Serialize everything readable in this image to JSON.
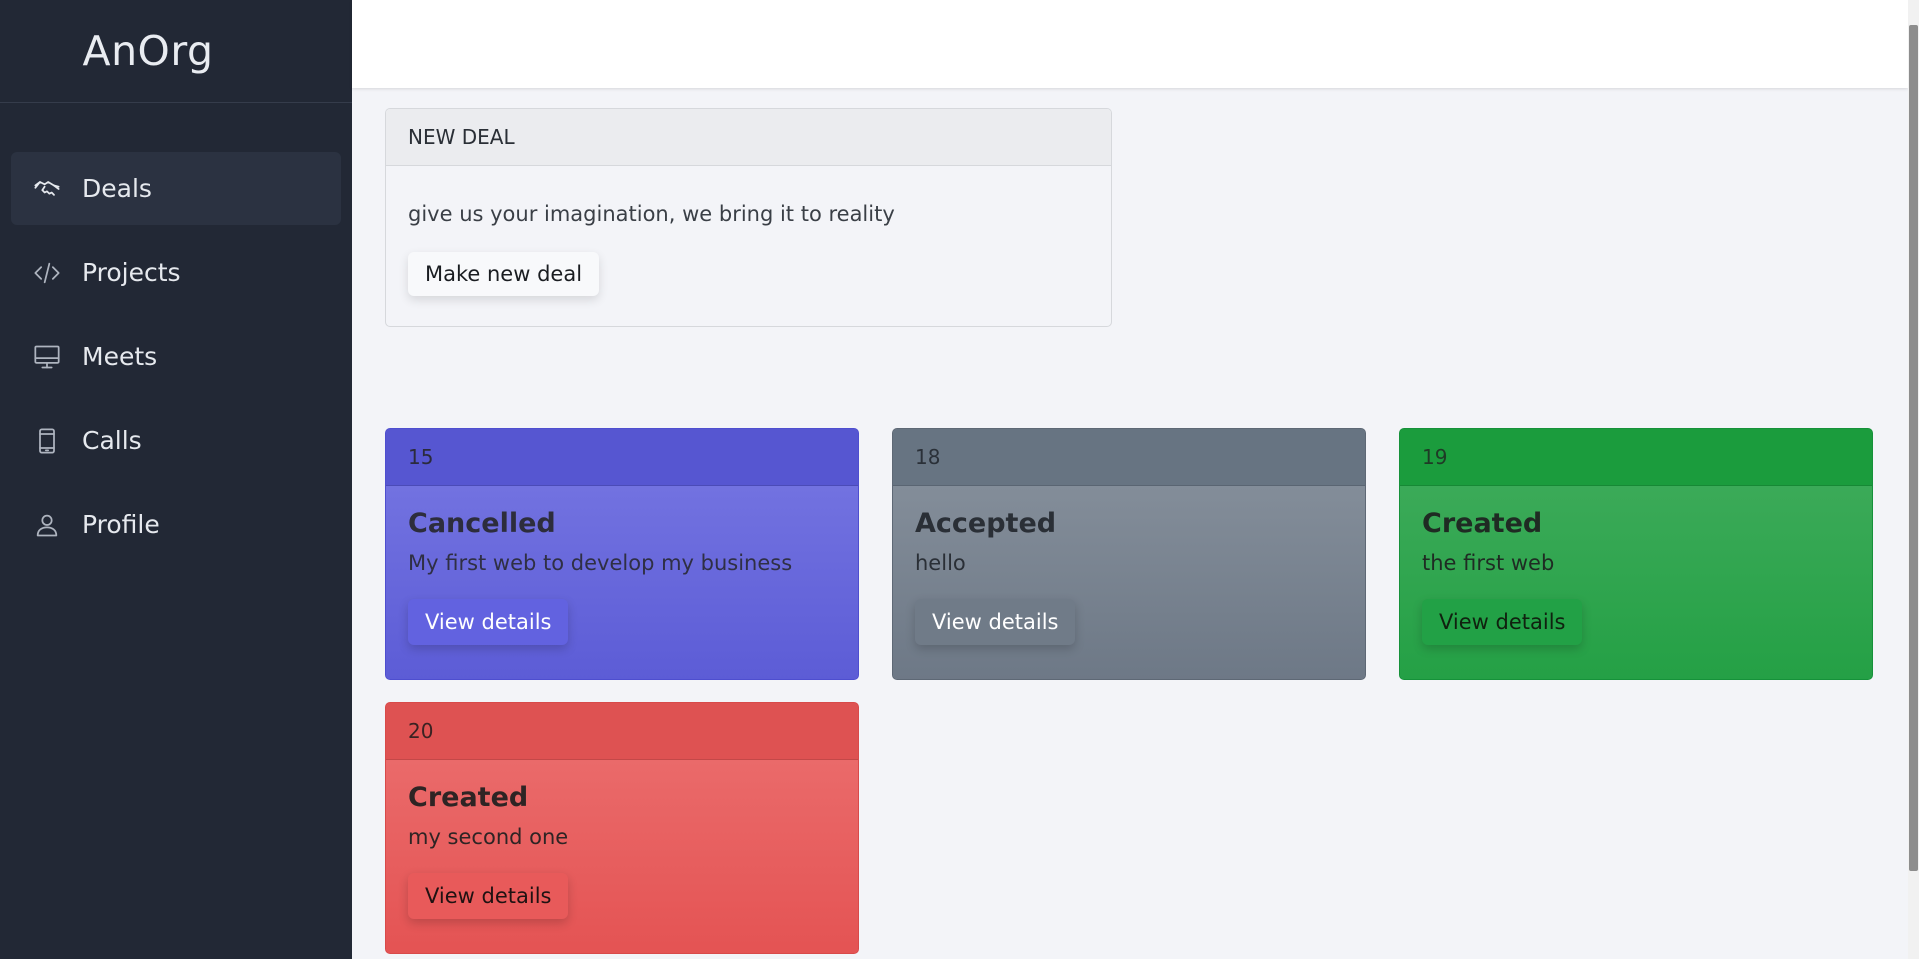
{
  "app": {
    "brand": "AnOrg"
  },
  "sidebar": {
    "items": [
      {
        "label": "Deals",
        "icon": "handshake-icon",
        "active": true
      },
      {
        "label": "Projects",
        "icon": "code-icon"
      },
      {
        "label": "Meets",
        "icon": "monitor-icon"
      },
      {
        "label": "Calls",
        "icon": "phone-icon"
      },
      {
        "label": "Profile",
        "icon": "person-icon"
      }
    ]
  },
  "new_deal": {
    "header": "NEW DEAL",
    "text": "give us your imagination, we bring it to reality",
    "button_label": "Make new deal"
  },
  "deals": [
    {
      "id": "15",
      "status": "Cancelled",
      "description": "My first web to develop my business",
      "button_label": "View details",
      "color": "#6363d9"
    },
    {
      "id": "18",
      "status": "Accepted",
      "description": "hello",
      "button_label": "View details",
      "color": "#778390"
    },
    {
      "id": "19",
      "status": "Created",
      "description": "the first web",
      "button_label": "View details",
      "color": "#2aa44a"
    },
    {
      "id": "20",
      "status": "Created",
      "description": "my second one",
      "button_label": "View details",
      "color": "#e55656"
    }
  ]
}
